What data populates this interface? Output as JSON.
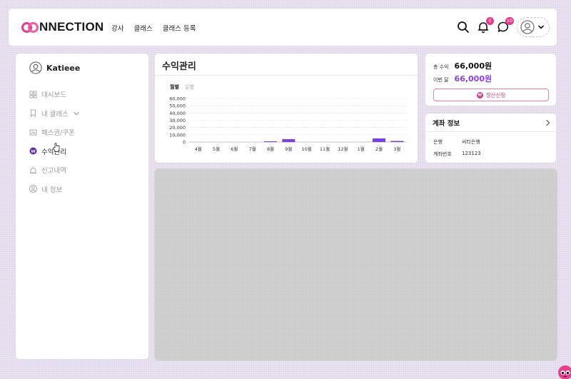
{
  "header": {
    "logo_text": "NNECTION",
    "nav": [
      "강사",
      "클래스",
      "클래스 등록"
    ],
    "notifications_count": "0",
    "messages_count": "10"
  },
  "sidebar": {
    "username": "Katieee",
    "items": [
      {
        "label": "대시보드",
        "icon": "dashboard-icon",
        "active": false
      },
      {
        "label": "내 클래스",
        "icon": "bookmark-icon",
        "active": false
      },
      {
        "label": "패스권/쿠폰",
        "icon": "ticket-icon",
        "active": false
      },
      {
        "label": "수익관리",
        "icon": "won-icon",
        "active": true
      },
      {
        "label": "신고내역",
        "icon": "report-icon",
        "active": false
      },
      {
        "label": "내 정보",
        "icon": "user-icon",
        "active": false
      }
    ]
  },
  "revenue": {
    "title": "수익관리",
    "tabs": [
      "월별",
      "일별"
    ]
  },
  "chart_data": {
    "type": "bar",
    "categories": [
      "4월",
      "5월",
      "6월",
      "7월",
      "8월",
      "9월",
      "10월",
      "11월",
      "12월",
      "1월",
      "2월",
      "3월"
    ],
    "values": [
      0,
      0,
      0,
      0,
      1000,
      4000,
      0,
      0,
      0,
      0,
      5000,
      1500
    ],
    "ylim": [
      0,
      60000
    ],
    "yticks": [
      "60,000",
      "50,000",
      "40,000",
      "30,000",
      "20,000",
      "10,000",
      "0"
    ],
    "bar_color": "#7b3fe4",
    "grid": true
  },
  "summary": {
    "total_label": "총 수익",
    "total_value": "66,000원",
    "month_label": "이번 달",
    "month_value": "66,000원",
    "settle_label": "정산신청"
  },
  "account": {
    "title": "계좌 정보",
    "bank_label": "은행",
    "bank_value": "씨티은행",
    "number_label": "계좌번호",
    "number_value": "123123"
  },
  "colors": {
    "accent_pink": "#e73a8c",
    "accent_purple": "#8a3fe0"
  }
}
